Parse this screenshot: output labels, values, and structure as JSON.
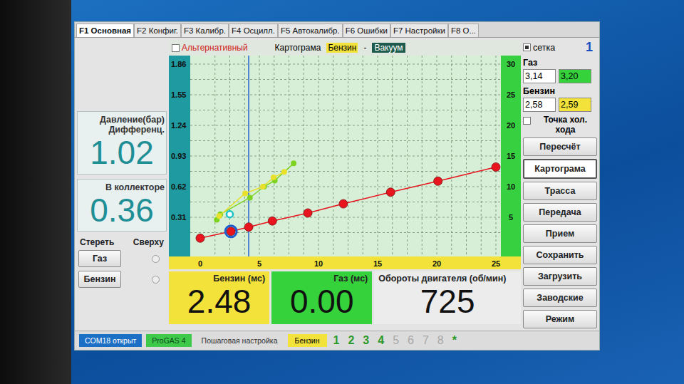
{
  "tabs": [
    {
      "label": "F1 Основная",
      "selected": true
    },
    {
      "label": "F2 Конфиг.",
      "selected": false
    },
    {
      "label": "F3 Калибр.",
      "selected": false
    },
    {
      "label": "F4 Осцилл.",
      "selected": false
    },
    {
      "label": "F5 Автокалибр.",
      "selected": false
    },
    {
      "label": "F6 Ошибки",
      "selected": false
    },
    {
      "label": "F7 Настройки",
      "selected": false
    },
    {
      "label": "F8 О...",
      "selected": false
    }
  ],
  "pressure": [
    {
      "label_lines": [
        "Давление(бар)",
        "Дифференц."
      ],
      "value": "1.02"
    },
    {
      "label_lines": [
        "В коллекторе"
      ],
      "value": "0.36"
    }
  ],
  "erase": {
    "labels": [
      "Стереть",
      "Сверху"
    ],
    "rows": [
      {
        "label": "Газ",
        "checked": false
      },
      {
        "label": "Бензин",
        "checked": false
      }
    ]
  },
  "chart_header": {
    "alternative": {
      "label": "Альтернативный",
      "checked": false
    },
    "title": "Картограма",
    "fuel": "Бензин",
    "separator": "-",
    "mode": "Вакуум"
  },
  "chart": {
    "left_ticks": [
      "0.31",
      "0.62",
      "0.93",
      "1.24",
      "1.55",
      "1.86"
    ],
    "right_ticks": [
      "5",
      "10",
      "15",
      "20",
      "25",
      "30"
    ],
    "bottom_ticks": [
      "0",
      "5",
      "10",
      "15",
      "20",
      "25"
    ],
    "series": [
      {
        "name": "correction",
        "color": "#e8141e",
        "x": [
          0,
          2.6,
          4.1,
          6.1,
          9.1,
          12.1,
          16.1,
          20.1,
          25
        ],
        "y": [
          1.6,
          2.7,
          3.4,
          4.4,
          5.7,
          7.2,
          9.1,
          10.9,
          13.2
        ]
      },
      {
        "name": "gas",
        "color": "#7ed321",
        "x": [
          1.4,
          1.7,
          4.2,
          5.4,
          6.3,
          7.9
        ],
        "y": [
          4.6,
          5.5,
          8.2,
          10.0,
          11.0,
          13.8
        ]
      },
      {
        "name": "petrol",
        "color": "#e8e02a",
        "x": [
          1.6,
          3.8,
          5.3,
          6.2,
          7.1
        ],
        "y": [
          5.2,
          8.9,
          10.0,
          11.5,
          12.4
        ]
      }
    ],
    "cursor": {
      "x": 4.1,
      "color": "#1e5fd0"
    },
    "selected_point": {
      "series": 0,
      "index": 1
    },
    "marker": {
      "x": 2.5,
      "y": 5.5,
      "color": "#19c3c8"
    }
  },
  "readouts": [
    {
      "label": "Бензин (мс)",
      "value": "2.48",
      "color": "#f2e23a"
    },
    {
      "label": "Газ (мс)",
      "value": "0.00",
      "color": "#36d23c"
    },
    {
      "label": "Обороты двигателя (об/мин)",
      "value": "725",
      "color": "#ececec"
    }
  ],
  "side": {
    "grid": {
      "label": "сетка",
      "checked": true
    },
    "number": "1",
    "fields": [
      {
        "label": "Газ",
        "values": [
          {
            "text": "3,14",
            "color": "#ffffff"
          },
          {
            "text": "3,20",
            "color": "#36d23c"
          }
        ]
      },
      {
        "label": "Бензин",
        "values": [
          {
            "text": "2,58",
            "color": "#ffffff"
          },
          {
            "text": "2,59",
            "color": "#f2e23a"
          }
        ]
      }
    ],
    "idle": {
      "label": "Точка хол. хода",
      "checked": false
    },
    "buttons": [
      {
        "label": "Пересчёт",
        "pressed": false
      },
      {
        "label": "Картограма",
        "pressed": true
      },
      {
        "label": "Трасса",
        "pressed": false
      },
      {
        "label": "Передача",
        "pressed": false
      },
      {
        "label": "Прием",
        "pressed": false
      },
      {
        "label": "Сохранить",
        "pressed": false
      },
      {
        "label": "Загрузить",
        "pressed": false
      },
      {
        "label": "Заводские",
        "pressed": false
      },
      {
        "label": "Режим",
        "pressed": false
      }
    ]
  },
  "status_bar": {
    "port": "COM18 открыт",
    "device": "ProGAS 4",
    "mode": "Пошаговая настройка",
    "fuel": "Бензин",
    "steps": [
      {
        "label": "1",
        "enabled": true
      },
      {
        "label": "2",
        "enabled": true
      },
      {
        "label": "3",
        "enabled": true
      },
      {
        "label": "4",
        "enabled": true
      },
      {
        "label": "5",
        "enabled": false
      },
      {
        "label": "6",
        "enabled": false
      },
      {
        "label": "7",
        "enabled": false
      },
      {
        "label": "8",
        "enabled": false
      }
    ],
    "star": "*"
  }
}
